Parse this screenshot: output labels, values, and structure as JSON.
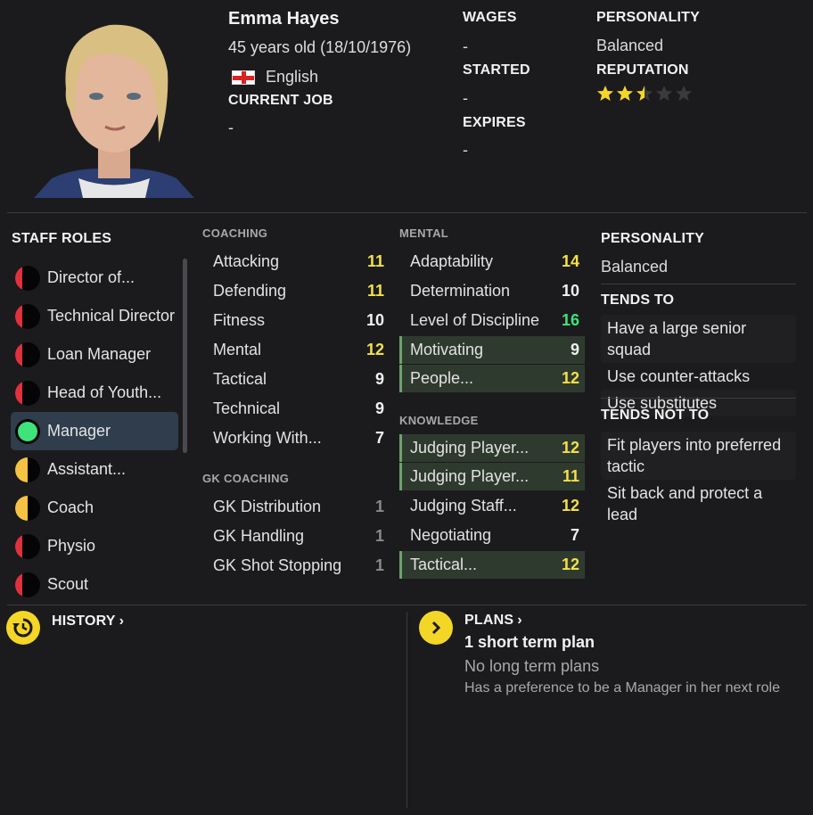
{
  "header": {
    "name": "Emma Hayes",
    "age_text": "45 years old",
    "dob": "(18/10/1976)",
    "nationality": "English",
    "current_job_label": "CURRENT JOB",
    "current_job_value": "-",
    "wages_label": "WAGES",
    "wages_value": "-",
    "started_label": "STARTED",
    "started_value": "-",
    "expires_label": "EXPIRES",
    "expires_value": "-",
    "personality_label": "PERSONALITY",
    "personality_value": "Balanced",
    "reputation_label": "REPUTATION",
    "reputation_stars": 2.5,
    "reputation_max": 5
  },
  "staff_roles": {
    "label": "STAFF ROLES",
    "items": [
      {
        "name": "Director of...",
        "suitability": "low"
      },
      {
        "name": "Technical Director",
        "suitability": "low"
      },
      {
        "name": "Loan Manager",
        "suitability": "low"
      },
      {
        "name": "Head of Youth...",
        "suitability": "low"
      },
      {
        "name": "Manager",
        "suitability": "full",
        "selected": true
      },
      {
        "name": "Assistant...",
        "suitability": "half"
      },
      {
        "name": "Coach",
        "suitability": "half"
      },
      {
        "name": "Physio",
        "suitability": "low"
      },
      {
        "name": "Scout",
        "suitability": "low"
      }
    ]
  },
  "coaching": {
    "label": "COACHING",
    "items": [
      {
        "name": "Attacking",
        "value": "11",
        "color": "yellow"
      },
      {
        "name": "Defending",
        "value": "11",
        "color": "yellow"
      },
      {
        "name": "Fitness",
        "value": "10",
        "color": "white"
      },
      {
        "name": "Mental",
        "value": "12",
        "color": "yellow"
      },
      {
        "name": "Tactical",
        "value": "9",
        "color": "white"
      },
      {
        "name": "Technical",
        "value": "9",
        "color": "white"
      },
      {
        "name": "Working With...",
        "value": "7",
        "color": "white"
      }
    ]
  },
  "gk_coaching": {
    "label": "GK COACHING",
    "items": [
      {
        "name": "GK Distribution",
        "value": "1",
        "color": "gray"
      },
      {
        "name": "GK Handling",
        "value": "1",
        "color": "gray"
      },
      {
        "name": "GK Shot Stopping",
        "value": "1",
        "color": "gray"
      }
    ]
  },
  "mental": {
    "label": "MENTAL",
    "items": [
      {
        "name": "Adaptability",
        "value": "14",
        "color": "yellow"
      },
      {
        "name": "Determination",
        "value": "10",
        "color": "white"
      },
      {
        "name": "Level of Discipline",
        "value": "16",
        "color": "green"
      },
      {
        "name": "Motivating",
        "value": "9",
        "color": "white",
        "highlight": true
      },
      {
        "name": "People...",
        "value": "12",
        "color": "yellow",
        "highlight": true
      }
    ]
  },
  "knowledge": {
    "label": "KNOWLEDGE",
    "items": [
      {
        "name": "Judging Player...",
        "value": "12",
        "color": "yellow",
        "highlight": true
      },
      {
        "name": "Judging Player...",
        "value": "11",
        "color": "yellow",
        "highlight": true
      },
      {
        "name": "Judging Staff...",
        "value": "12",
        "color": "yellow"
      },
      {
        "name": "Negotiating",
        "value": "7",
        "color": "white"
      },
      {
        "name": "Tactical...",
        "value": "12",
        "color": "yellow",
        "highlight": true
      }
    ]
  },
  "right_panel": {
    "personality_label": "PERSONALITY",
    "personality_value": "Balanced",
    "tends_to_label": "TENDS TO",
    "tends_to": [
      "Have a large senior squad",
      "Use counter-attacks",
      "Use substitutes"
    ],
    "tends_not_to_label": "TENDS NOT TO",
    "tends_not_to": [
      "Fit players into preferred tactic",
      "Sit back and protect a lead"
    ]
  },
  "history": {
    "label": "HISTORY"
  },
  "plans": {
    "label": "PLANS",
    "short_term": "1 short term plan",
    "long_term": "No long term plans",
    "preference": "Has a preference to be a Manager in her next role"
  },
  "colors": {
    "yellow": "#f3e04a",
    "green": "#3ee37a",
    "red": "#e0313f",
    "accent": "#f4d626",
    "selected_bg": "#2f3d4d"
  }
}
